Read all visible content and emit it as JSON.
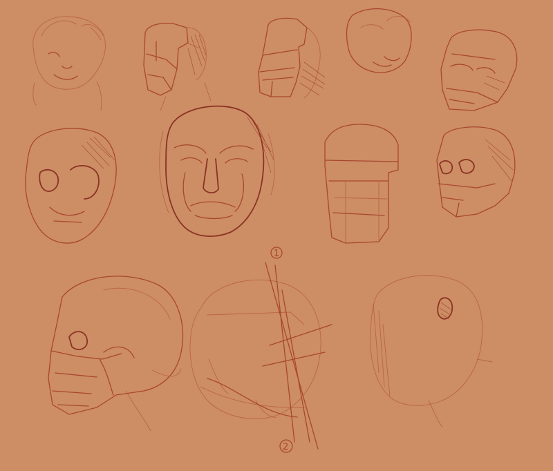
{
  "canvas": {
    "background": "#cd8d65",
    "ink": "#a8472f",
    "ink_dark": "#8a3322"
  },
  "annotations": {
    "marker_1": "1",
    "marker_2": "2"
  }
}
